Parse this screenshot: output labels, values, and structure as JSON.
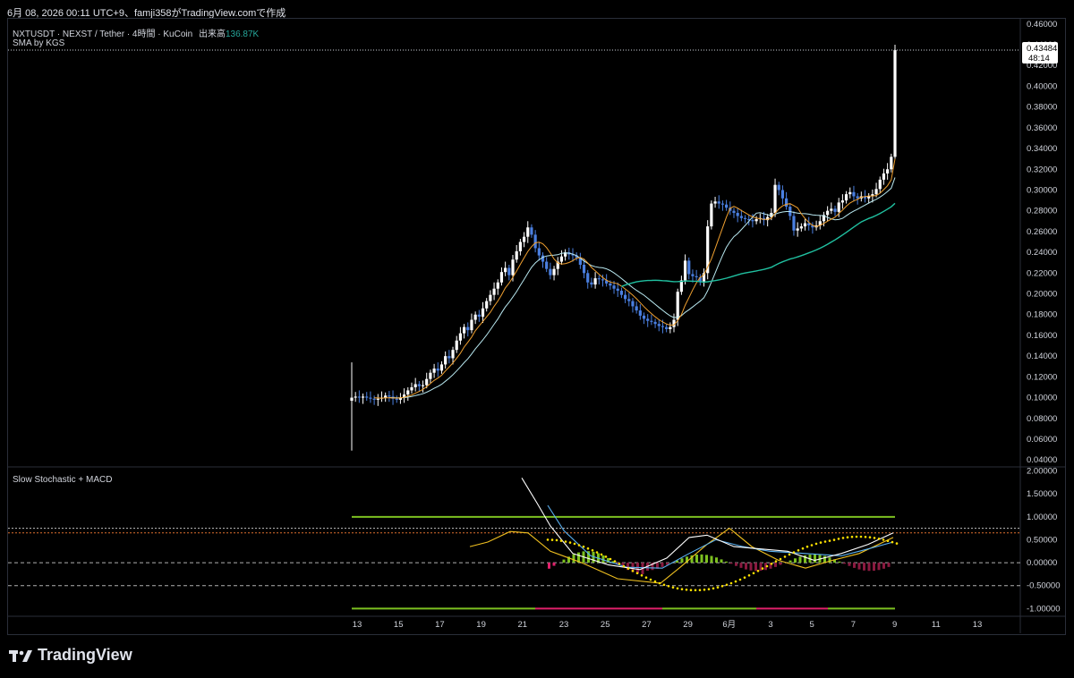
{
  "header": {
    "caption": "6月 08, 2026 00:11 UTC+9、famji358がTradingView.comで作成"
  },
  "legend": {
    "symbol": "NXTUSDT · NEXST / Tether · 4時間 · KuCoin",
    "volume_label": "出来高",
    "volume_value": "136.87K",
    "indicator_main": "SMA by KGS",
    "indicator_sub": "Slow Stochastic + MACD"
  },
  "price_badge": {
    "price": "0.43484",
    "countdown": "48:14"
  },
  "footer": {
    "brand": "TradingView"
  },
  "colors": {
    "background": "#000000",
    "candle_up": "#ffffff",
    "candle_down": "#4a7fe0",
    "sma_fast": "#f0a030",
    "sma_mid": "#b8e8f0",
    "sma_slow": "#20c0a0",
    "stoch_k": "#ffffff",
    "stoch_d": "#5ab0f0",
    "macd_line": "#f0c020",
    "signal_dots": "#ffe000",
    "band": "#7cc020",
    "band_neg": "#e0206a"
  },
  "chart_data": [
    {
      "type": "candlestick",
      "title": "NXTUSDT",
      "y_axis": {
        "labels": [
          "0.46000",
          "0.44000",
          "0.42000",
          "0.40000",
          "0.38000",
          "0.36000",
          "0.34000",
          "0.32000",
          "0.30000",
          "0.28000",
          "0.26000",
          "0.24000",
          "0.22000",
          "0.20000",
          "0.18000",
          "0.16000",
          "0.14000",
          "0.12000",
          "0.10000",
          "0.08000",
          "0.06000",
          "0.04000"
        ],
        "ylim": [
          0.035,
          0.465
        ]
      },
      "x_axis": {
        "labels": [
          "13",
          "15",
          "17",
          "19",
          "21",
          "23",
          "25",
          "27",
          "29",
          "6月",
          "3",
          "5",
          "7",
          "9",
          "11",
          "13"
        ]
      },
      "last_price": 0.43484,
      "series_close": [
        0.1,
        0.101,
        0.1,
        0.101,
        0.1,
        0.099,
        0.098,
        0.099,
        0.1,
        0.102,
        0.101,
        0.099,
        0.098,
        0.1,
        0.103,
        0.107,
        0.11,
        0.113,
        0.111,
        0.112,
        0.118,
        0.124,
        0.128,
        0.126,
        0.132,
        0.14,
        0.138,
        0.146,
        0.155,
        0.162,
        0.168,
        0.165,
        0.175,
        0.18,
        0.178,
        0.186,
        0.193,
        0.199,
        0.205,
        0.211,
        0.221,
        0.225,
        0.218,
        0.233,
        0.241,
        0.25,
        0.255,
        0.264,
        0.257,
        0.244,
        0.237,
        0.231,
        0.224,
        0.218,
        0.224,
        0.231,
        0.236,
        0.24,
        0.238,
        0.237,
        0.235,
        0.228,
        0.22,
        0.211,
        0.209,
        0.215,
        0.214,
        0.213,
        0.21,
        0.208,
        0.205,
        0.203,
        0.199,
        0.195,
        0.193,
        0.188,
        0.184,
        0.179,
        0.176,
        0.174,
        0.173,
        0.171,
        0.169,
        0.168,
        0.166,
        0.168,
        0.175,
        0.202,
        0.213,
        0.232,
        0.219,
        0.217,
        0.216,
        0.212,
        0.22,
        0.265,
        0.287,
        0.289,
        0.287,
        0.286,
        0.283,
        0.28,
        0.278,
        0.275,
        0.273,
        0.272,
        0.271,
        0.27,
        0.272,
        0.273,
        0.271,
        0.274,
        0.278,
        0.305,
        0.3,
        0.292,
        0.284,
        0.275,
        0.261,
        0.263,
        0.265,
        0.268,
        0.266,
        0.264,
        0.266,
        0.27,
        0.276,
        0.28,
        0.282,
        0.279,
        0.288,
        0.29,
        0.296,
        0.298,
        0.294,
        0.292,
        0.294,
        0.292,
        0.294,
        0.296,
        0.301,
        0.31,
        0.316,
        0.32,
        0.332,
        0.43484
      ],
      "sma_fast_note": "SMA (orange)",
      "sma_mid_note": "SMA (light blue)",
      "sma_slow_note": "SMA (teal)"
    },
    {
      "type": "line",
      "title": "Slow Stochastic + MACD",
      "y_axis": {
        "labels": [
          "2.00000",
          "1.50000",
          "1.00000",
          "0.50000",
          "0.00000",
          "-0.50000",
          "-1.00000"
        ],
        "ylim": [
          -1.15,
          2.05
        ]
      },
      "reference_levels": [
        1.0,
        0.75,
        0.65,
        0.0,
        -0.35,
        -0.5,
        -1.0
      ]
    }
  ]
}
